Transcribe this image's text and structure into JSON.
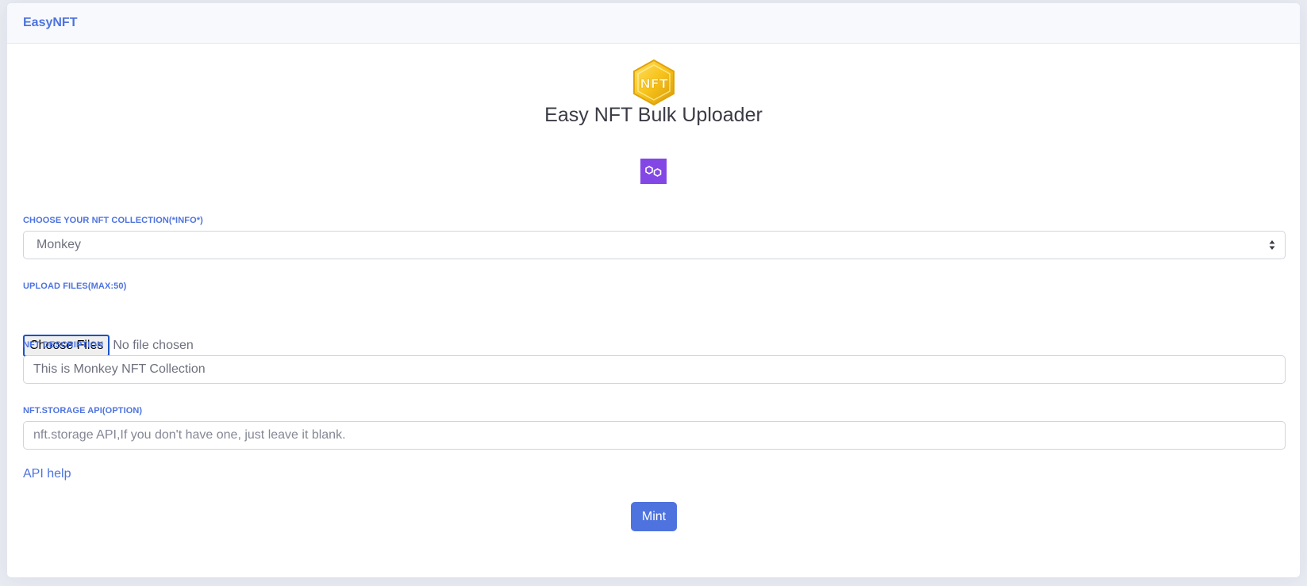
{
  "header": {
    "brand": "EasyNFT"
  },
  "hero": {
    "logo_icon": "nft-hexagon-logo-icon",
    "title": "Easy NFT Bulk Uploader",
    "chain_icon": "polygon-chain-icon",
    "chain_color": "#8247e5"
  },
  "form": {
    "collection": {
      "label": "CHOOSE YOUR NFT COLLECTION(*INFO*)",
      "selected": "Monkey"
    },
    "upload": {
      "label": "UPLOAD FILES(MAX:50)",
      "button_label": "Choose Files",
      "status": "No file chosen"
    },
    "description": {
      "label": "NFT DESCRIPTION",
      "value": "This is Monkey NFT Collection"
    },
    "api": {
      "label": "NFT.STORAGE API(OPTION)",
      "placeholder": "nft.storage API,If you don't have one, just leave it blank.",
      "help_link": "API help"
    },
    "submit_label": "Mint"
  },
  "colors": {
    "accent": "#4e73df",
    "header_bg": "#f8f9fc",
    "page_bg": "#eaecf4"
  }
}
